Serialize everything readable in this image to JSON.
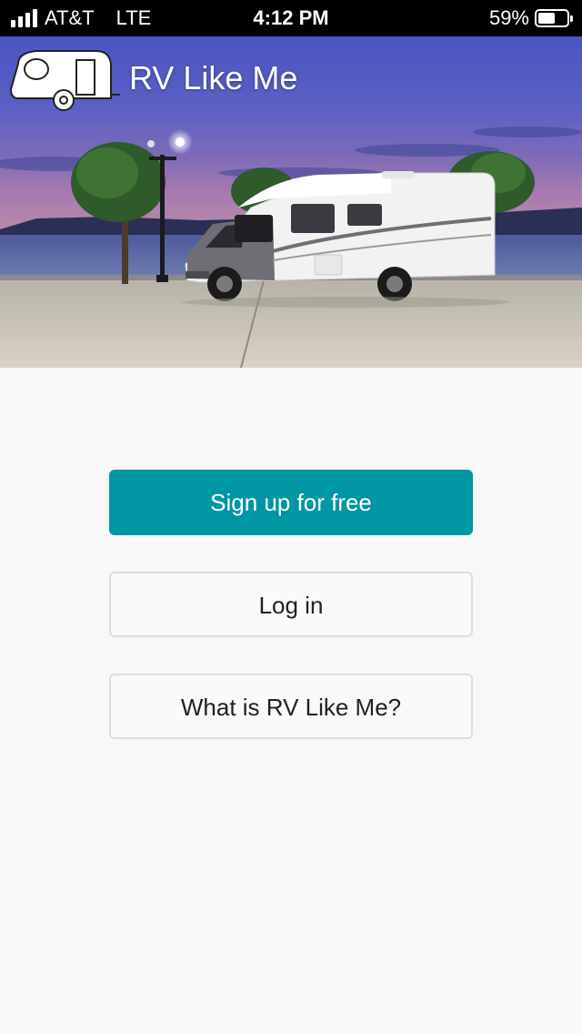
{
  "status_bar": {
    "carrier": "AT&T",
    "network": "LTE",
    "time": "4:12 PM",
    "battery_percent_label": "59%",
    "battery_level": 0.59
  },
  "header": {
    "logo_icon": "rv-trailer-icon",
    "app_title": "RV Like Me"
  },
  "actions": {
    "signup_label": "Sign up for free",
    "login_label": "Log in",
    "about_label": "What is RV Like Me?"
  },
  "colors": {
    "primary": "#0096a3",
    "background": "#f8f8f8",
    "status_bar": "#000000"
  }
}
